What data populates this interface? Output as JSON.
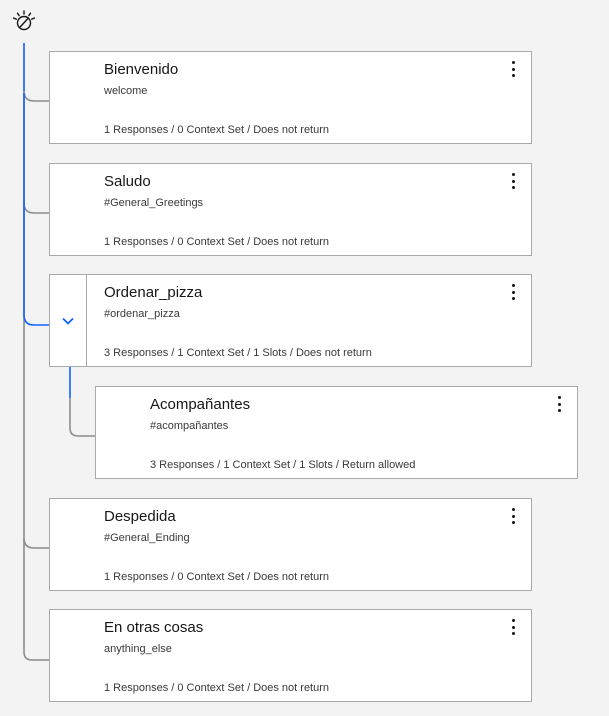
{
  "colors": {
    "accent": "#0f62fe",
    "connector": "#8d8d8d",
    "text": "#161616",
    "border": "#a9a9a9"
  },
  "root": {
    "icon": "watson-assistant-icon"
  },
  "nodes": [
    {
      "title": "Bienvenido",
      "condition": "welcome",
      "summary": "1 Responses / 0 Context Set / Does not return"
    },
    {
      "title": "Saludo",
      "condition": "#General_Greetings",
      "summary": "1 Responses / 0 Context Set / Does not return"
    },
    {
      "title": "Ordenar_pizza",
      "condition": "#ordenar_pizza",
      "summary": "3 Responses / 1 Context Set / 1 Slots / Does not return",
      "expanded": true
    },
    {
      "title": "Acompañantes",
      "condition": "#acompañantes",
      "summary": "3 Responses / 1 Context Set / 1 Slots / Return allowed"
    },
    {
      "title": "Despedida",
      "condition": "#General_Ending",
      "summary": "1 Responses / 0 Context Set / Does not return"
    },
    {
      "title": "En otras cosas",
      "condition": "anything_else",
      "summary": "1 Responses / 0 Context Set / Does not return"
    }
  ]
}
